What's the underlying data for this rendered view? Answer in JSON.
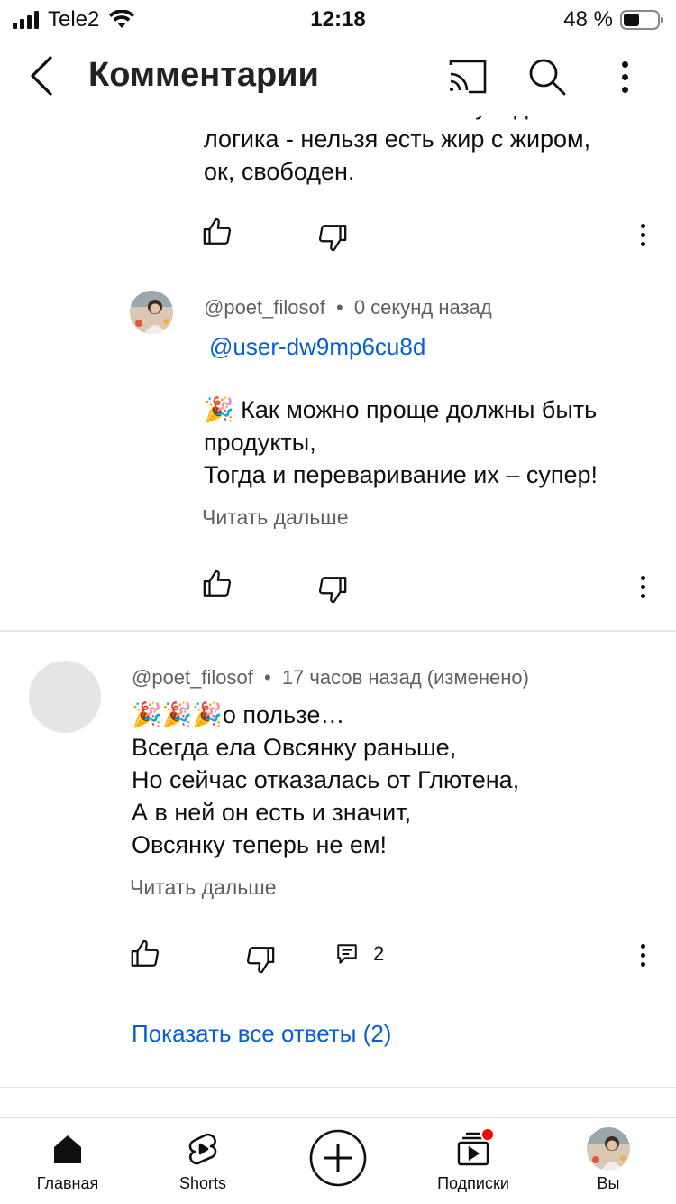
{
  "status_bar": {
    "carrier": "Tele2",
    "time": "12:18",
    "battery_percent": "48 %",
    "battery_level": 0.48
  },
  "header": {
    "title": "Комментарии",
    "icons": [
      "back-arrow-icon",
      "cast-icon",
      "search-icon",
      "more-vert-icon"
    ]
  },
  "comment_top_partial": {
    "lines": [
      "тоже же что ты плохого увидел? Твоя",
      "логика - нельзя есть жир с жиром,",
      "ок, свободен."
    ]
  },
  "reply": {
    "author": "@poet_filosof",
    "dot": "•",
    "time": "0 секунд назад",
    "mention": "@user-dw9mp6cu8d",
    "emoji": "🎉",
    "line1": "Как можно проще должны быть",
    "line2": "продукты,",
    "line3": "Тогда и переваривание их – супер!",
    "read_more": "Читать дальше"
  },
  "comment": {
    "author": "@poet_filosof",
    "dot": "•",
    "time": "17 часов назад (изменено)",
    "emojis": "🎉🎉🎉",
    "line1": "о пользе…",
    "line2": "Всегда ела Овсянку раньше,",
    "line3": "Но сейчас отказалась от Глютена,",
    "line4": "А в ней он есть и значит,",
    "line5": "Овсянку теперь не ем!",
    "read_more": "Читать дальше",
    "reply_count": "2",
    "show_replies": "Показать все ответы (2)"
  },
  "nav": {
    "home": "Главная",
    "shorts": "Shorts",
    "subscriptions": "Подписки",
    "you": "Вы"
  },
  "colors": {
    "link": "#065fd4",
    "meta": "#606060",
    "notification": "#ff0000"
  }
}
